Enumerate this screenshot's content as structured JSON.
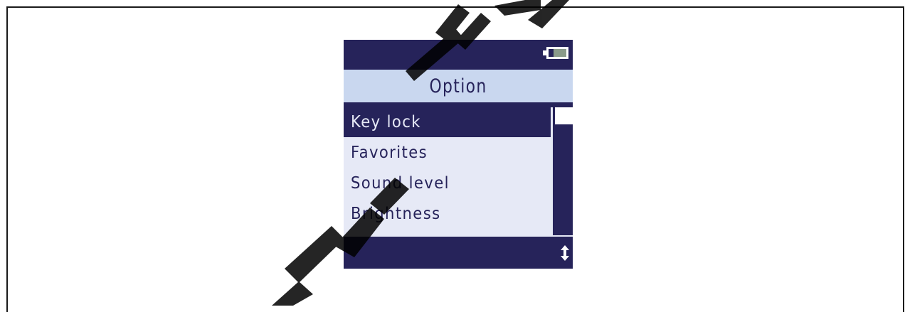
{
  "screen": {
    "title": "Option",
    "menu_items": [
      {
        "label": "Key lock",
        "selected": true
      },
      {
        "label": "Favorites",
        "selected": false
      },
      {
        "label": "Sound level",
        "selected": false
      },
      {
        "label": "Brightness",
        "selected": false
      }
    ],
    "status": {
      "battery_icon": "battery-icon"
    },
    "footer": {
      "scroll_icon": "up-down-arrow-icon"
    }
  },
  "colors": {
    "background": "#26235a",
    "title_bar": "#c9d7ef",
    "list_bg": "#e6e9f6",
    "selected_bg": "#26235a",
    "watermark": "#000000"
  }
}
